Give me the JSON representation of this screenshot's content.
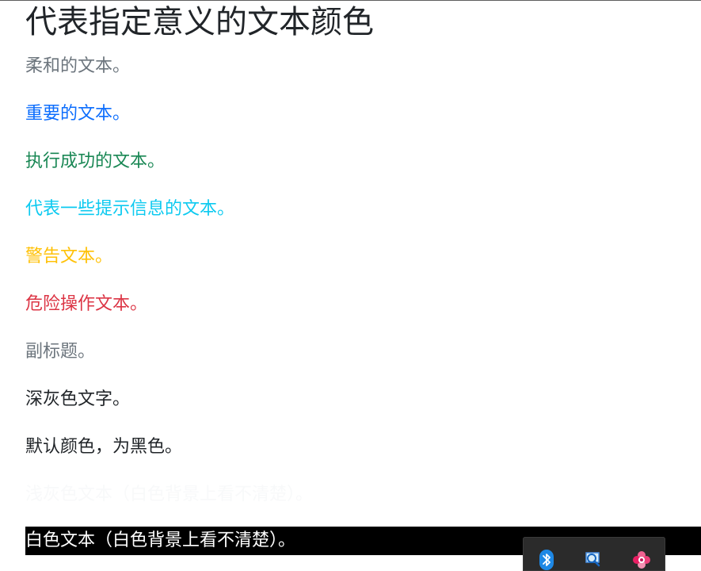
{
  "page": {
    "heading": "代表指定意义的文本颜色",
    "lines": {
      "muted": "柔和的文本。",
      "primary": "重要的文本。",
      "success": "执行成功的文本。",
      "info": "代表一些提示信息的文本。",
      "warning": "警告文本。",
      "danger": "危险操作文本。",
      "secondary": "副标题。",
      "dark": "深灰色文字。",
      "body": "默认颜色，为黑色。",
      "light": "浅灰色文本（白色背景上看不清楚）。",
      "white": "白色文本（白色背景上看不清楚）。"
    }
  },
  "colors": {
    "muted": "#6c757d",
    "primary": "#0d6efd",
    "success": "#198754",
    "info": "#0dcaf0",
    "warning": "#ffc107",
    "danger": "#dc3545",
    "secondary": "#6c757d",
    "dark": "#212529",
    "body": "#212529",
    "light": "#f8f9fa",
    "white": "#ffffff",
    "band": "#000000"
  },
  "tray": {
    "icons": [
      "bluetooth-icon",
      "search-icon",
      "app-flower-icon"
    ]
  }
}
